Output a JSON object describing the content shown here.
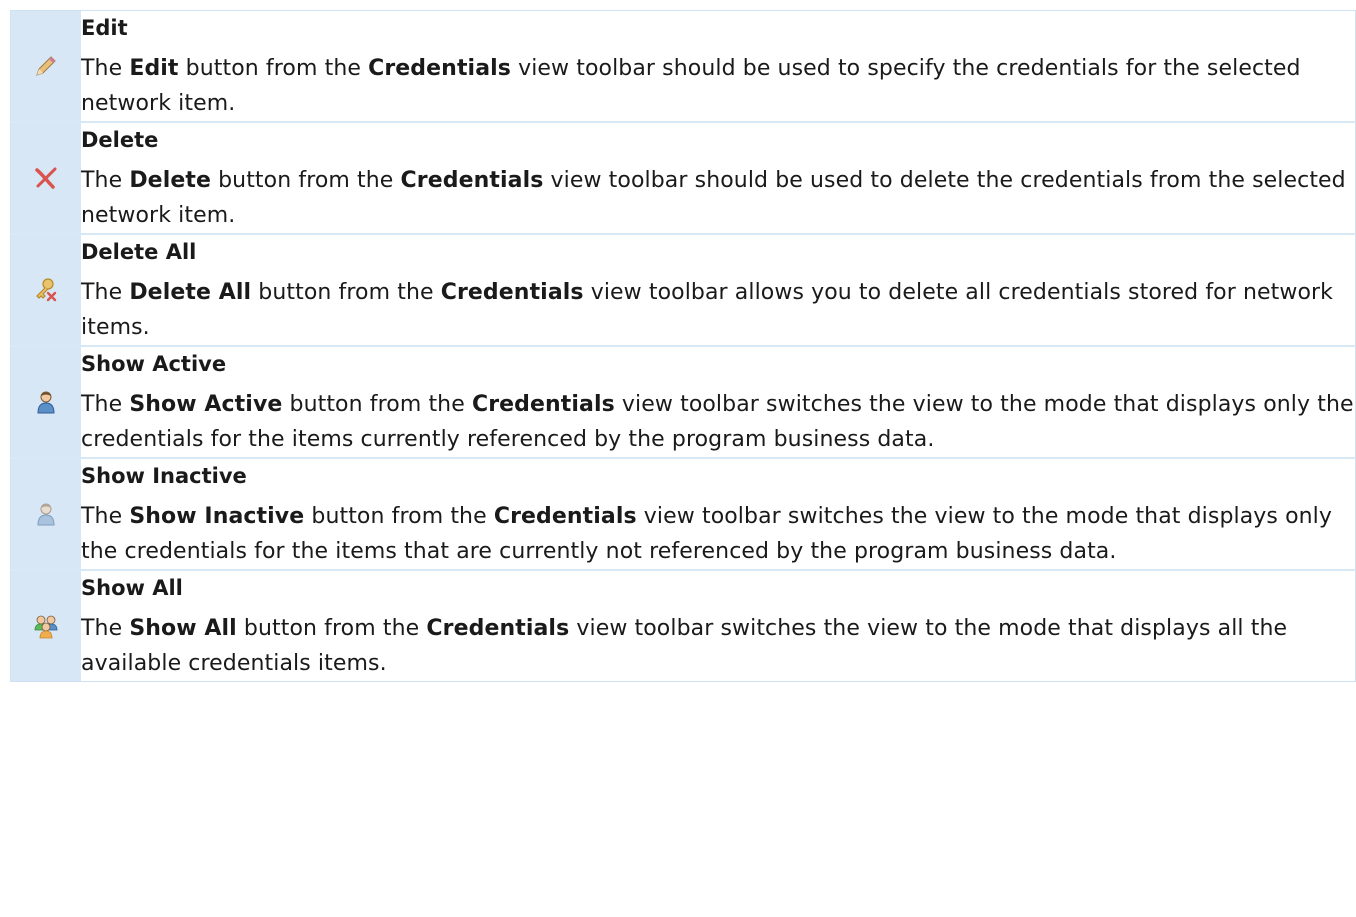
{
  "rows": [
    {
      "icon": "pencil-icon",
      "title": "Edit",
      "desc": [
        [
          "The ",
          false
        ],
        [
          "Edit",
          true
        ],
        [
          " button from the ",
          false
        ],
        [
          "Credentials",
          true
        ],
        [
          " view toolbar should be used to specify the credentials for the selected network item.",
          false
        ]
      ]
    },
    {
      "icon": "red-x-icon",
      "title": "Delete",
      "desc": [
        [
          "The ",
          false
        ],
        [
          "Delete",
          true
        ],
        [
          " button from the ",
          false
        ],
        [
          "Credentials",
          true
        ],
        [
          " view toolbar should be used to delete the credentials from the selected network item.",
          false
        ]
      ]
    },
    {
      "icon": "key-delete-icon",
      "title": "Delete All",
      "desc": [
        [
          "The ",
          false
        ],
        [
          "Delete All",
          true
        ],
        [
          " button from the ",
          false
        ],
        [
          "Credentials",
          true
        ],
        [
          " view toolbar allows you to delete all credentials stored for network items.",
          false
        ]
      ]
    },
    {
      "icon": "user-active-icon",
      "title": "Show Active",
      "desc": [
        [
          "The ",
          false
        ],
        [
          "Show Active",
          true
        ],
        [
          " button from the ",
          false
        ],
        [
          "Credentials",
          true
        ],
        [
          " view toolbar switches the view to the mode that displays only the credentials for the items currently referenced by the program business data.",
          false
        ]
      ]
    },
    {
      "icon": "user-inactive-icon",
      "title": "Show Inactive",
      "desc": [
        [
          "The ",
          false
        ],
        [
          "Show Inactive",
          true
        ],
        [
          " button from the ",
          false
        ],
        [
          "Credentials",
          true
        ],
        [
          " view toolbar switches the view to the mode that displays only the credentials for the items that are currently not referenced by the program business data.",
          false
        ]
      ]
    },
    {
      "icon": "users-group-icon",
      "title": "Show All",
      "desc": [
        [
          "The ",
          false
        ],
        [
          "Show All",
          true
        ],
        [
          " button from the ",
          false
        ],
        [
          "Credentials",
          true
        ],
        [
          " view toolbar switches the view to the mode that displays all the available credentials items.",
          false
        ]
      ]
    }
  ]
}
